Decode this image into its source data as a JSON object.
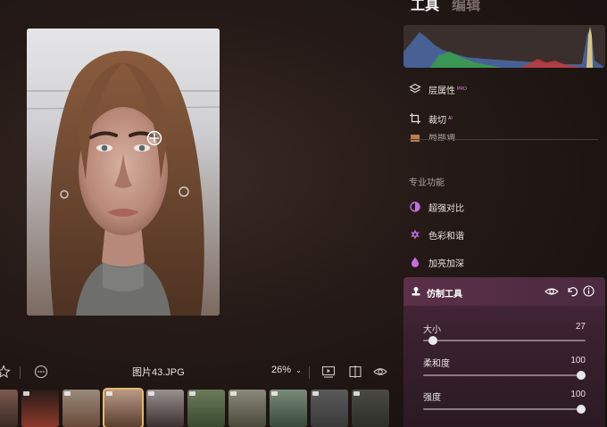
{
  "tabs": {
    "active": "工具",
    "inactive": "编辑"
  },
  "panel": {
    "rows": [
      {
        "label": "层属性",
        "tag": "PRO",
        "icon": "layers-icon"
      },
      {
        "label": "裁切",
        "tag": "AI",
        "icon": "crop-icon"
      },
      {
        "label": "局部调",
        "icon": "brush-icon"
      }
    ],
    "section_title": "专业功能",
    "pro_features": [
      {
        "label": "超强对比",
        "icon": "contrast-icon"
      },
      {
        "label": "色彩和谐",
        "icon": "color-harmony-icon"
      },
      {
        "label": "加亮加深",
        "icon": "dodge-burn-icon"
      }
    ],
    "clone_tool": {
      "title": "仿制工具",
      "sliders": [
        {
          "label": "大小",
          "value": "27",
          "fraction": 0.06
        },
        {
          "label": "柔和度",
          "value": "100",
          "fraction": 0.97
        },
        {
          "label": "强度",
          "value": "100",
          "fraction": 0.97
        }
      ]
    }
  },
  "toolbar": {
    "filename": "图片43.JPG",
    "zoom": "26%"
  },
  "colors": {
    "accent": "#c46ee0",
    "selected_thumb": "#e7b86a"
  }
}
